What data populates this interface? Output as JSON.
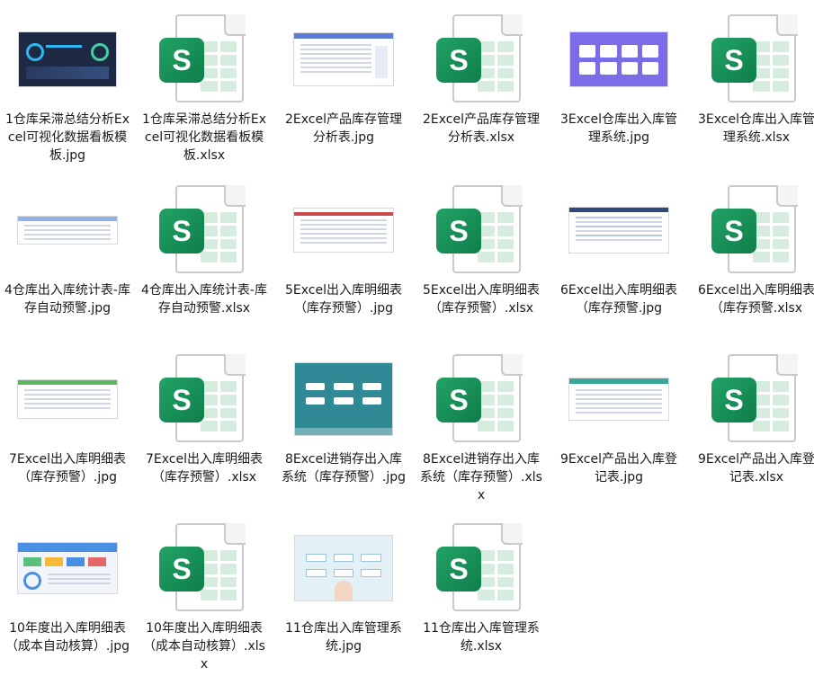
{
  "files": [
    {
      "name": "1仓库呆滞总结分析Excel可视化数据看板模板.jpg",
      "type": "jpg",
      "preview": "dashboard-dark"
    },
    {
      "name": "1仓库呆滞总结分析Excel可视化数据看板模板.xlsx",
      "type": "xlsx"
    },
    {
      "name": "2Excel产品库存管理分析表.jpg",
      "type": "jpg",
      "preview": "table-blue"
    },
    {
      "name": "2Excel产品库存管理分析表.xlsx",
      "type": "xlsx"
    },
    {
      "name": "3Excel仓库出入库管理系统.jpg",
      "type": "jpg",
      "preview": "menu-purple"
    },
    {
      "name": "3Excel仓库出入库管理系统.xlsx",
      "type": "xlsx"
    },
    {
      "name": "4仓库出入库统计表-库存自动预警.jpg",
      "type": "jpg",
      "preview": "table-wide"
    },
    {
      "name": "4仓库出入库统计表-库存自动预警.xlsx",
      "type": "xlsx"
    },
    {
      "name": "5Excel出入库明细表（库存预警）.jpg",
      "type": "jpg",
      "preview": "table-red"
    },
    {
      "name": "5Excel出入库明细表（库存预警）.xlsx",
      "type": "xlsx"
    },
    {
      "name": "6Excel出入库明细表（库存预警.jpg",
      "type": "jpg",
      "preview": "table-navy"
    },
    {
      "name": "6Excel出入库明细表（库存预警.xlsx",
      "type": "xlsx"
    },
    {
      "name": "7Excel出入库明细表（库存预警）.jpg",
      "type": "jpg",
      "preview": "table-green"
    },
    {
      "name": "7Excel出入库明细表（库存预警）.xlsx",
      "type": "xlsx"
    },
    {
      "name": "8Excel进销存出入库系统（库存预警）.jpg",
      "type": "jpg",
      "preview": "menu-teal"
    },
    {
      "name": "8Excel进销存出入库系统（库存预警）.xlsx",
      "type": "xlsx"
    },
    {
      "name": "9Excel产品出入库登记表.jpg",
      "type": "jpg",
      "preview": "table-teal"
    },
    {
      "name": "9Excel产品出入库登记表.xlsx",
      "type": "xlsx"
    },
    {
      "name": "10年度出入库明细表（成本自动核算）.jpg",
      "type": "jpg",
      "preview": "dashboard-light"
    },
    {
      "name": "10年度出入库明细表（成本自动核算）.xlsx",
      "type": "xlsx"
    },
    {
      "name": "11仓库出入库管理系统.jpg",
      "type": "jpg",
      "preview": "menu-sky"
    },
    {
      "name": "11仓库出入库管理系统.xlsx",
      "type": "xlsx"
    }
  ],
  "icon_letter": "S",
  "colors": {
    "excel_green": "#1a9a5c",
    "excel_green_dark": "#0f7d4a"
  }
}
